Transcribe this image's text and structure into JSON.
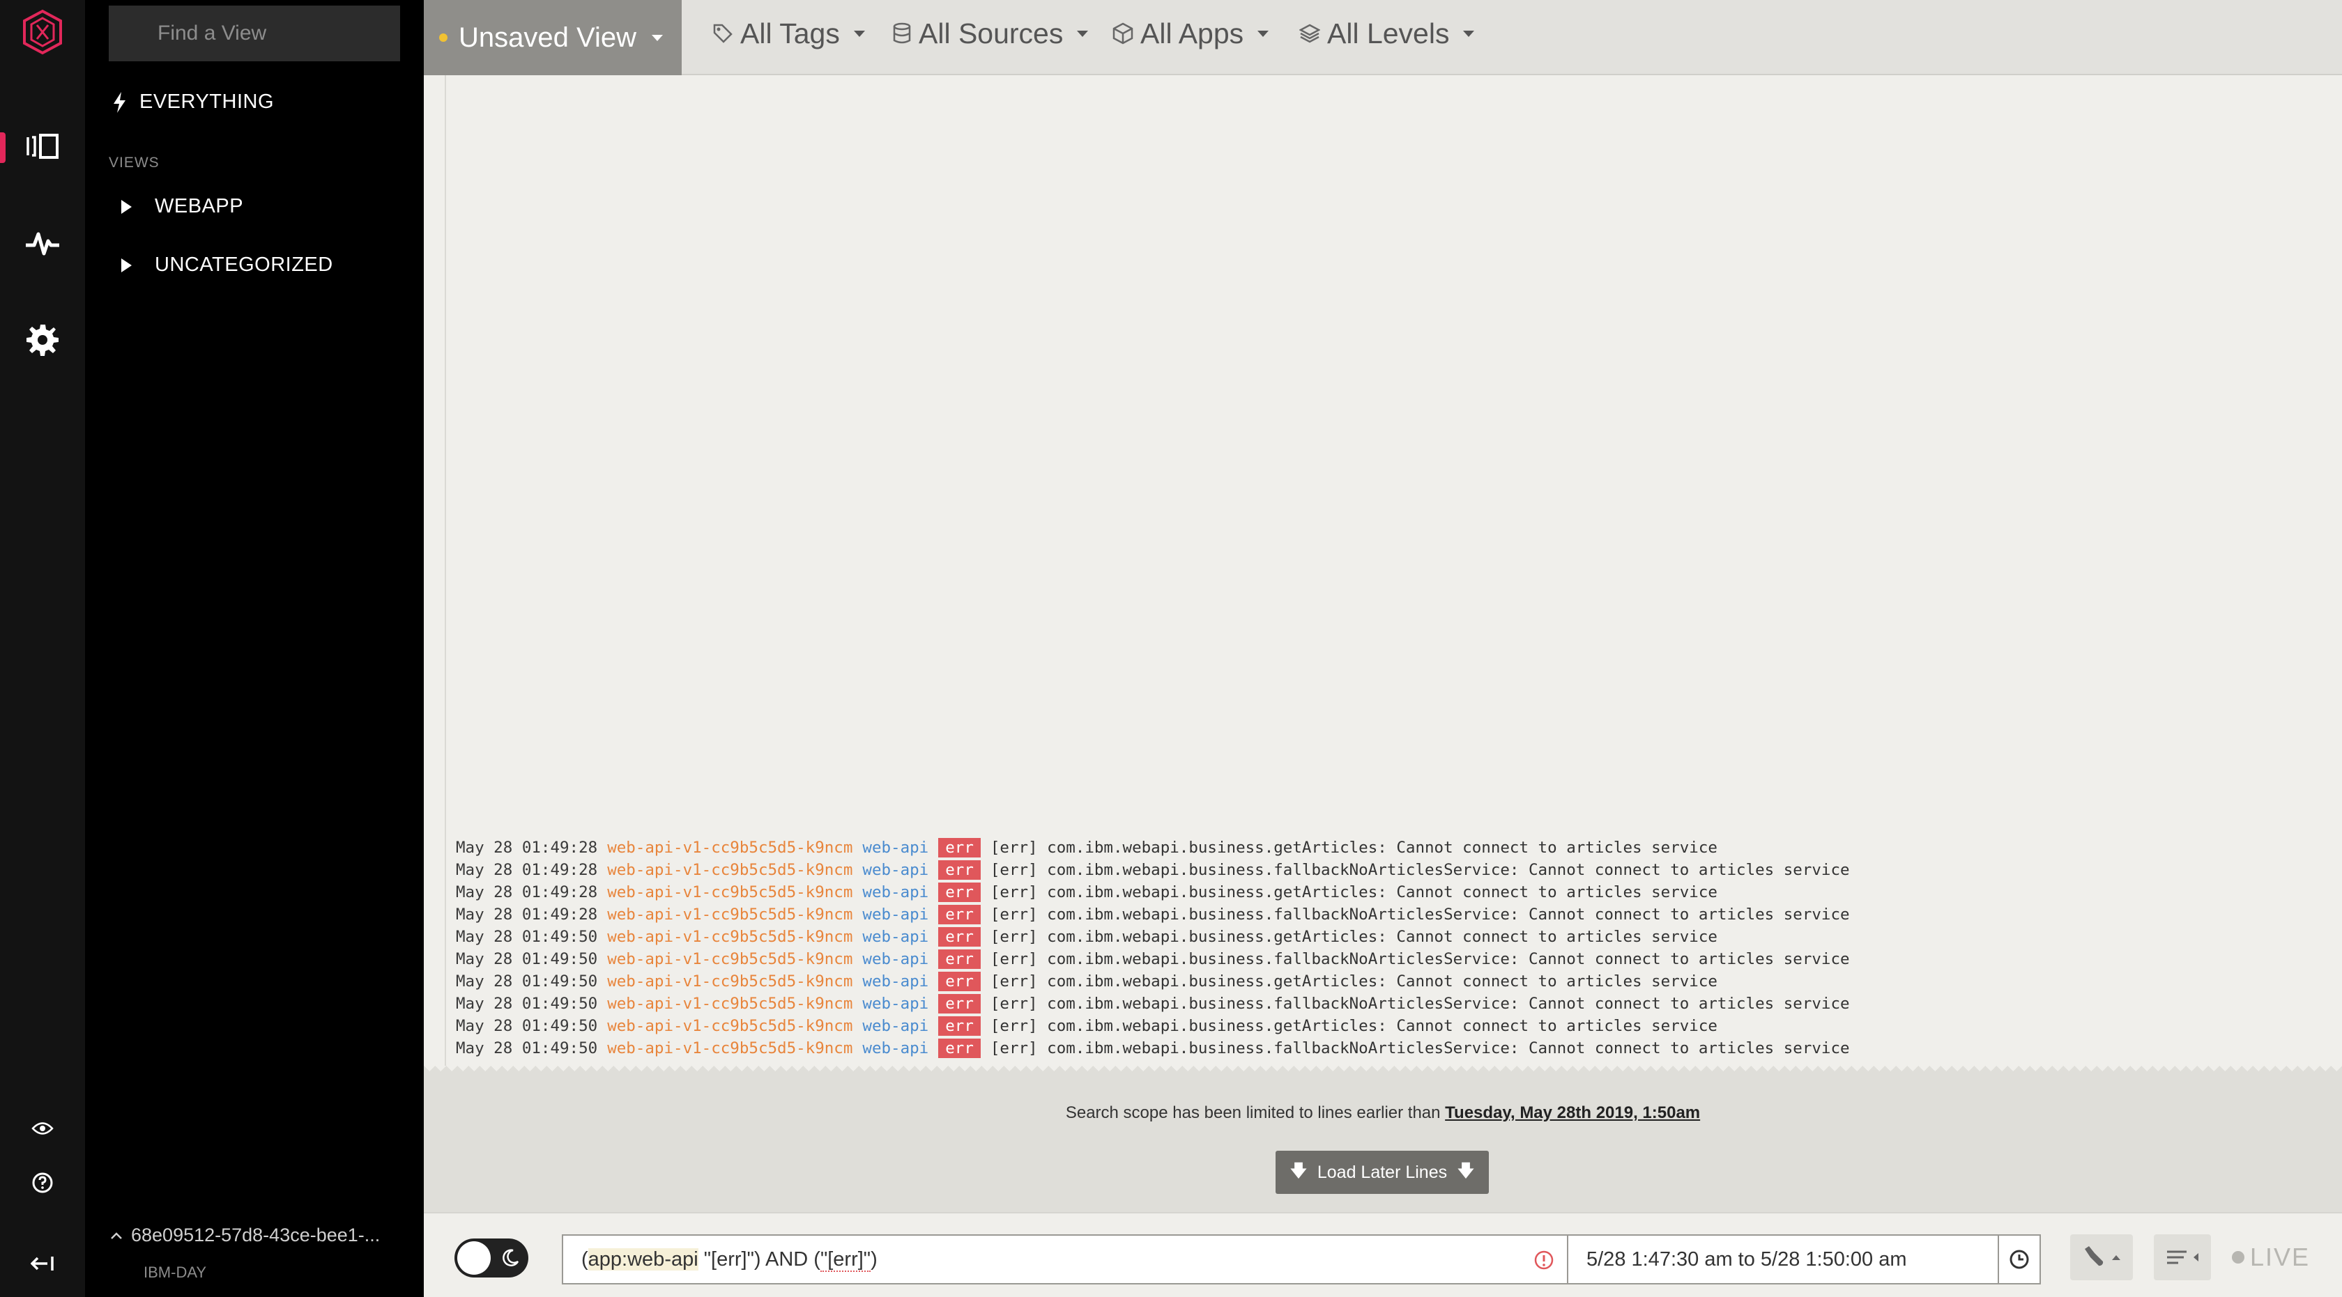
{
  "rail": {
    "items": [
      "logo-icon",
      "views-icon",
      "graphs-icon",
      "settings-icon",
      "eye-icon",
      "help-icon",
      "collapse-icon"
    ],
    "accent": "#e2275a"
  },
  "sidebar": {
    "search_placeholder": "Find a View",
    "everything_label": "EVERYTHING",
    "views_section_label": "VIEWS",
    "categories": [
      {
        "label": "WEBAPP"
      },
      {
        "label": "UNCATEGORIZED"
      }
    ],
    "org": {
      "id": "68e09512-57d8-43ce-bee1-...",
      "name": "IBM-DAY"
    }
  },
  "topbar": {
    "view_selector": "Unsaved View",
    "filters": {
      "tags": "All Tags",
      "sources": "All Sources",
      "apps": "All Apps",
      "levels": "All Levels"
    }
  },
  "log": {
    "lines": [
      {
        "ts": "May 28 01:49:28",
        "host": "web-api-v1-cc9b5c5d5-k9ncm",
        "app": "web-api",
        "level": "err",
        "msg": "[err] com.ibm.webapi.business.getArticles: Cannot connect to articles service"
      },
      {
        "ts": "May 28 01:49:28",
        "host": "web-api-v1-cc9b5c5d5-k9ncm",
        "app": "web-api",
        "level": "err",
        "msg": "[err] com.ibm.webapi.business.fallbackNoArticlesService: Cannot connect to articles service"
      },
      {
        "ts": "May 28 01:49:28",
        "host": "web-api-v1-cc9b5c5d5-k9ncm",
        "app": "web-api",
        "level": "err",
        "msg": "[err] com.ibm.webapi.business.getArticles: Cannot connect to articles service"
      },
      {
        "ts": "May 28 01:49:28",
        "host": "web-api-v1-cc9b5c5d5-k9ncm",
        "app": "web-api",
        "level": "err",
        "msg": "[err] com.ibm.webapi.business.fallbackNoArticlesService: Cannot connect to articles service"
      },
      {
        "ts": "May 28 01:49:50",
        "host": "web-api-v1-cc9b5c5d5-k9ncm",
        "app": "web-api",
        "level": "err",
        "msg": "[err] com.ibm.webapi.business.getArticles: Cannot connect to articles service"
      },
      {
        "ts": "May 28 01:49:50",
        "host": "web-api-v1-cc9b5c5d5-k9ncm",
        "app": "web-api",
        "level": "err",
        "msg": "[err] com.ibm.webapi.business.fallbackNoArticlesService: Cannot connect to articles service"
      },
      {
        "ts": "May 28 01:49:50",
        "host": "web-api-v1-cc9b5c5d5-k9ncm",
        "app": "web-api",
        "level": "err",
        "msg": "[err] com.ibm.webapi.business.getArticles: Cannot connect to articles service"
      },
      {
        "ts": "May 28 01:49:50",
        "host": "web-api-v1-cc9b5c5d5-k9ncm",
        "app": "web-api",
        "level": "err",
        "msg": "[err] com.ibm.webapi.business.fallbackNoArticlesService: Cannot connect to articles service"
      },
      {
        "ts": "May 28 01:49:50",
        "host": "web-api-v1-cc9b5c5d5-k9ncm",
        "app": "web-api",
        "level": "err",
        "msg": "[err] com.ibm.webapi.business.getArticles: Cannot connect to articles service"
      },
      {
        "ts": "May 28 01:49:50",
        "host": "web-api-v1-cc9b5c5d5-k9ncm",
        "app": "web-api",
        "level": "err",
        "msg": "[err] com.ibm.webapi.business.fallbackNoArticlesService: Cannot connect to articles service"
      }
    ],
    "colors": {
      "host": "#e8853c",
      "app": "#4a8bcf",
      "level_bg": "#e0575b"
    }
  },
  "scope": {
    "text": "Search scope has been limited to lines earlier than",
    "date": "Tuesday, May 28th 2019, 1:50am",
    "load_button": "Load Later Lines"
  },
  "bottombar": {
    "query_app": "app:web-api",
    "query_rest_1": "\"[err]\") AND (",
    "query_rest_2": "\"[err]\"",
    "query_rest_3": ")",
    "time_range": "5/28 1:47:30 am to 5/28 1:50:00 am",
    "live_label": "LIVE"
  }
}
